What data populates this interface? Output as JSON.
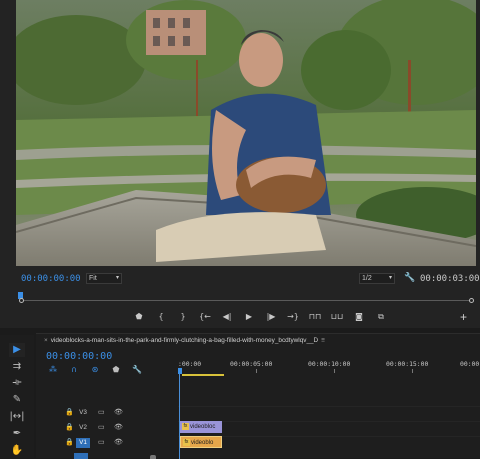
{
  "monitor": {
    "timecode_current": "00:00:00:00",
    "zoom_select": "Fit",
    "quality_select": "1/2",
    "timecode_duration": "00:00:03:00",
    "transport": [
      {
        "name": "add-marker-icon",
        "glyph": "⬟"
      },
      {
        "name": "mark-in-icon",
        "glyph": "{"
      },
      {
        "name": "mark-out-icon",
        "glyph": "}"
      },
      {
        "name": "go-to-in-icon",
        "glyph": "{←"
      },
      {
        "name": "step-back-icon",
        "glyph": "◀|"
      },
      {
        "name": "play-icon",
        "glyph": "▶"
      },
      {
        "name": "step-forward-icon",
        "glyph": "|▶"
      },
      {
        "name": "go-to-out-icon",
        "glyph": "→}"
      },
      {
        "name": "lift-icon",
        "glyph": "⊓⊓"
      },
      {
        "name": "extract-icon",
        "glyph": "⊔⊔"
      },
      {
        "name": "export-frame-icon",
        "glyph": "◙"
      },
      {
        "name": "comparison-view-icon",
        "glyph": "⧉"
      }
    ],
    "plus_label": "+"
  },
  "tools": [
    {
      "name": "selection-tool-icon",
      "glyph": "▶",
      "active": true
    },
    {
      "name": "track-select-tool-icon",
      "glyph": "⇉",
      "active": false
    },
    {
      "name": "ripple-edit-tool-icon",
      "glyph": "⟛",
      "active": false
    },
    {
      "name": "razor-tool-icon",
      "glyph": "✎",
      "active": false
    },
    {
      "name": "slip-tool-icon",
      "glyph": "|↔|",
      "active": false
    },
    {
      "name": "pen-tool-icon",
      "glyph": "✒",
      "active": false
    },
    {
      "name": "hand-tool-icon",
      "glyph": "✋",
      "active": false
    }
  ],
  "timeline": {
    "tab_close": "×",
    "sequence_name": "videoblocks-a-man-sits-in-the-park-and-firmly-clutching-a-bag-filled-with-money_bcdtywlqv__D",
    "tab_menu": "≡",
    "timecode": "00:00:00:00",
    "ruler": [
      ":00:00",
      "00:00:05:00",
      "00:00:10:00",
      "00:00:15:00",
      "00:00"
    ],
    "tracks": [
      {
        "name": "V3",
        "active": false
      },
      {
        "name": "V2",
        "active": false
      },
      {
        "name": "V1",
        "active": true
      }
    ],
    "clips": {
      "v2_label": "videobloc",
      "v1_label": "videoblo",
      "fx_label": "fx"
    },
    "colors": {
      "accent_blue": "#3b8fe6",
      "clip_v2": "#9a94d8",
      "clip_v1": "#e6a64a",
      "inout_bar": "#d8c23a"
    }
  }
}
